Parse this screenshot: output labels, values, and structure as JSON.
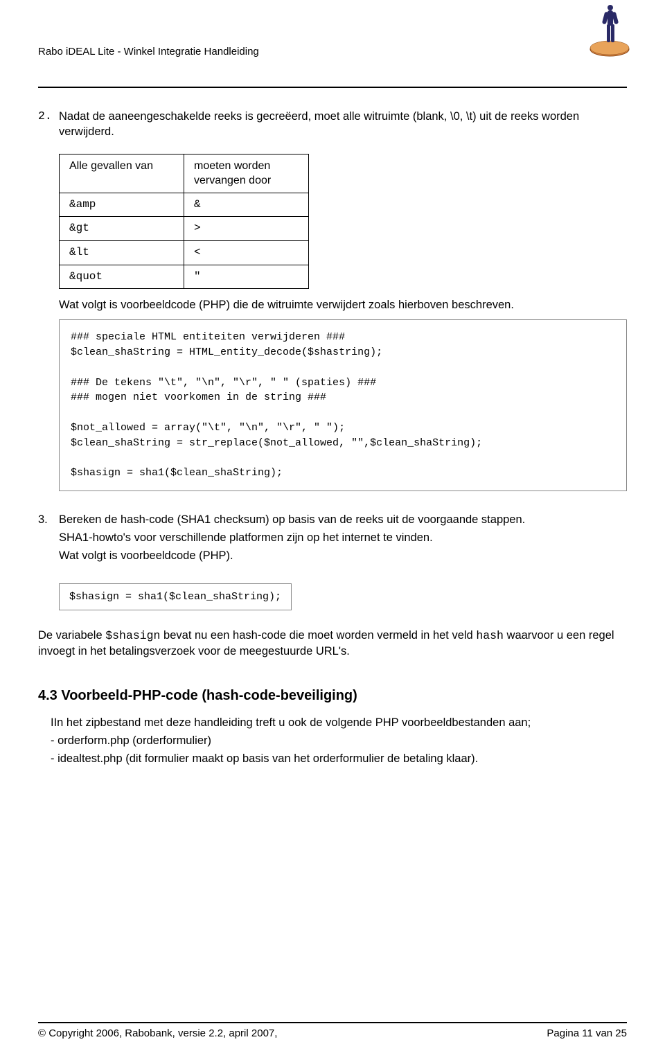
{
  "header": {
    "title": "Rabo iDEAL Lite -  Winkel Integratie Handleiding"
  },
  "step2": {
    "num": "2.",
    "text": "Nadat de aaneengeschakelde reeks is gecreëerd, moet alle witruimte (blank, \\0, \\t) uit de reeks worden verwijderd."
  },
  "table": {
    "h1": "Alle gevallen van",
    "h2": "moeten worden vervangen door",
    "rows": [
      {
        "a": "&amp",
        "b": "&"
      },
      {
        "a": "&gt",
        "b": ">"
      },
      {
        "a": "&lt",
        "b": "<"
      },
      {
        "a": "&quot",
        "b": "\""
      }
    ]
  },
  "after_table": "Wat volgt is voorbeeldcode (PHP) die de witruimte verwijdert zoals hierboven beschreven.",
  "code1": "### speciale HTML entiteiten verwijderen ###\n$clean_shaString = HTML_entity_decode($shastring);\n\n### De tekens \"\\t\", \"\\n\", \"\\r\", \" \" (spaties) ###\n### mogen niet voorkomen in de string ###\n\n$not_allowed = array(\"\\t\", \"\\n\", \"\\r\", \" \");\n$clean_shaString = str_replace($not_allowed, \"\",$clean_shaString);\n\n$shasign = sha1($clean_shaString);",
  "step3": {
    "num": "3.",
    "l1": "Bereken de hash-code (SHA1 checksum) op basis van de reeks uit de voorgaande stappen.",
    "l2": "SHA1-howto's voor verschillende platformen zijn op het internet te vinden.",
    "l3": "Wat volgt is voorbeeldcode (PHP)."
  },
  "code2": "$shasign = sha1($clean_shaString);",
  "para": {
    "p1a": "De variabele ",
    "p1b": "$shasign",
    "p1c": " bevat nu een hash-code die moet worden vermeld in het veld ",
    "p1d": "hash",
    "p1e": " waarvoor u een regel invoegt in het betalingsverzoek voor de meegestuurde URL's."
  },
  "section": {
    "title": "4.3   Voorbeeld-PHP-code (hash-code-beveiliging)",
    "l1": "IIn het zipbestand met deze handleiding treft u ook de volgende  PHP voorbeeldbestanden aan;",
    "l2": "- orderform.php (orderformulier)",
    "l3": "- idealtest.php (dit formulier maakt op basis van het orderformulier de betaling klaar)."
  },
  "footer": {
    "left": "© Copyright 2006, Rabobank, versie 2.2, april 2007,",
    "right": "Pagina 11 van 25"
  }
}
